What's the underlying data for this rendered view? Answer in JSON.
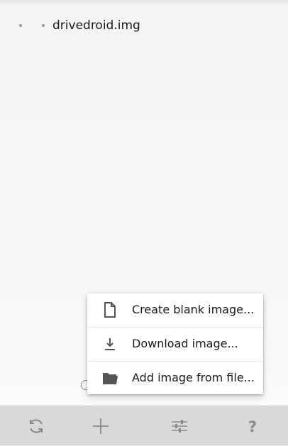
{
  "image_list": {
    "items": [
      {
        "name": "drivedroid.img"
      }
    ]
  },
  "popup_menu": {
    "items": [
      {
        "label": "Create blank image...",
        "icon": "blank-file-icon"
      },
      {
        "label": "Download image...",
        "icon": "download-icon"
      },
      {
        "label": "Add image from file...",
        "icon": "folder-icon"
      }
    ]
  },
  "toolbar": {
    "buttons": [
      {
        "icon": "refresh-icon"
      },
      {
        "icon": "plus-icon"
      },
      {
        "icon": "settings-sliders-icon"
      },
      {
        "icon": "help-icon",
        "glyph": "?"
      }
    ]
  },
  "colors": {
    "background": "#f4f4f4",
    "toolbar": "#d9d9d9",
    "menu": "#ffffff",
    "icon": "#8a8a8a",
    "text": "#1a1a1a"
  }
}
